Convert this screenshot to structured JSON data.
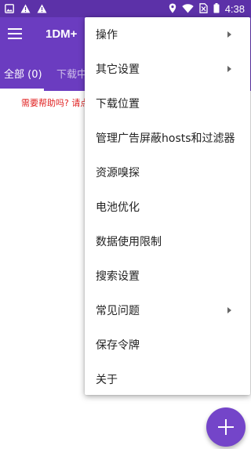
{
  "status_bar": {
    "time": "4:38",
    "left_icons": [
      "image-icon",
      "warning-icon",
      "warning-icon"
    ],
    "right_icons": [
      "location-icon",
      "wifi-icon",
      "no-sim-icon",
      "battery-icon"
    ]
  },
  "app_bar": {
    "menu_icon": "hamburger-icon",
    "title": "1DM+"
  },
  "tabs": [
    {
      "label": "全部 (0)"
    },
    {
      "label": "下载中"
    }
  ],
  "help_text": "需要帮助吗? 请点",
  "menu": {
    "items": [
      {
        "label": "操作",
        "has_submenu": true
      },
      {
        "label": "其它设置",
        "has_submenu": true
      },
      {
        "label": "下载位置",
        "has_submenu": false
      },
      {
        "label": "管理广告屏蔽hosts和过滤器",
        "has_submenu": false
      },
      {
        "label": "资源嗅探",
        "has_submenu": false
      },
      {
        "label": "电池优化",
        "has_submenu": false
      },
      {
        "label": "数据使用限制",
        "has_submenu": false
      },
      {
        "label": "搜索设置",
        "has_submenu": false
      },
      {
        "label": "常见问题",
        "has_submenu": true
      },
      {
        "label": "保存令牌",
        "has_submenu": false
      },
      {
        "label": "关于",
        "has_submenu": false
      }
    ]
  },
  "fab": {
    "icon": "plus-icon"
  },
  "colors": {
    "primary": "#6b3cc0",
    "status_bar": "#5c31a8",
    "fab": "#7445c9",
    "help_text": "#e02020"
  }
}
